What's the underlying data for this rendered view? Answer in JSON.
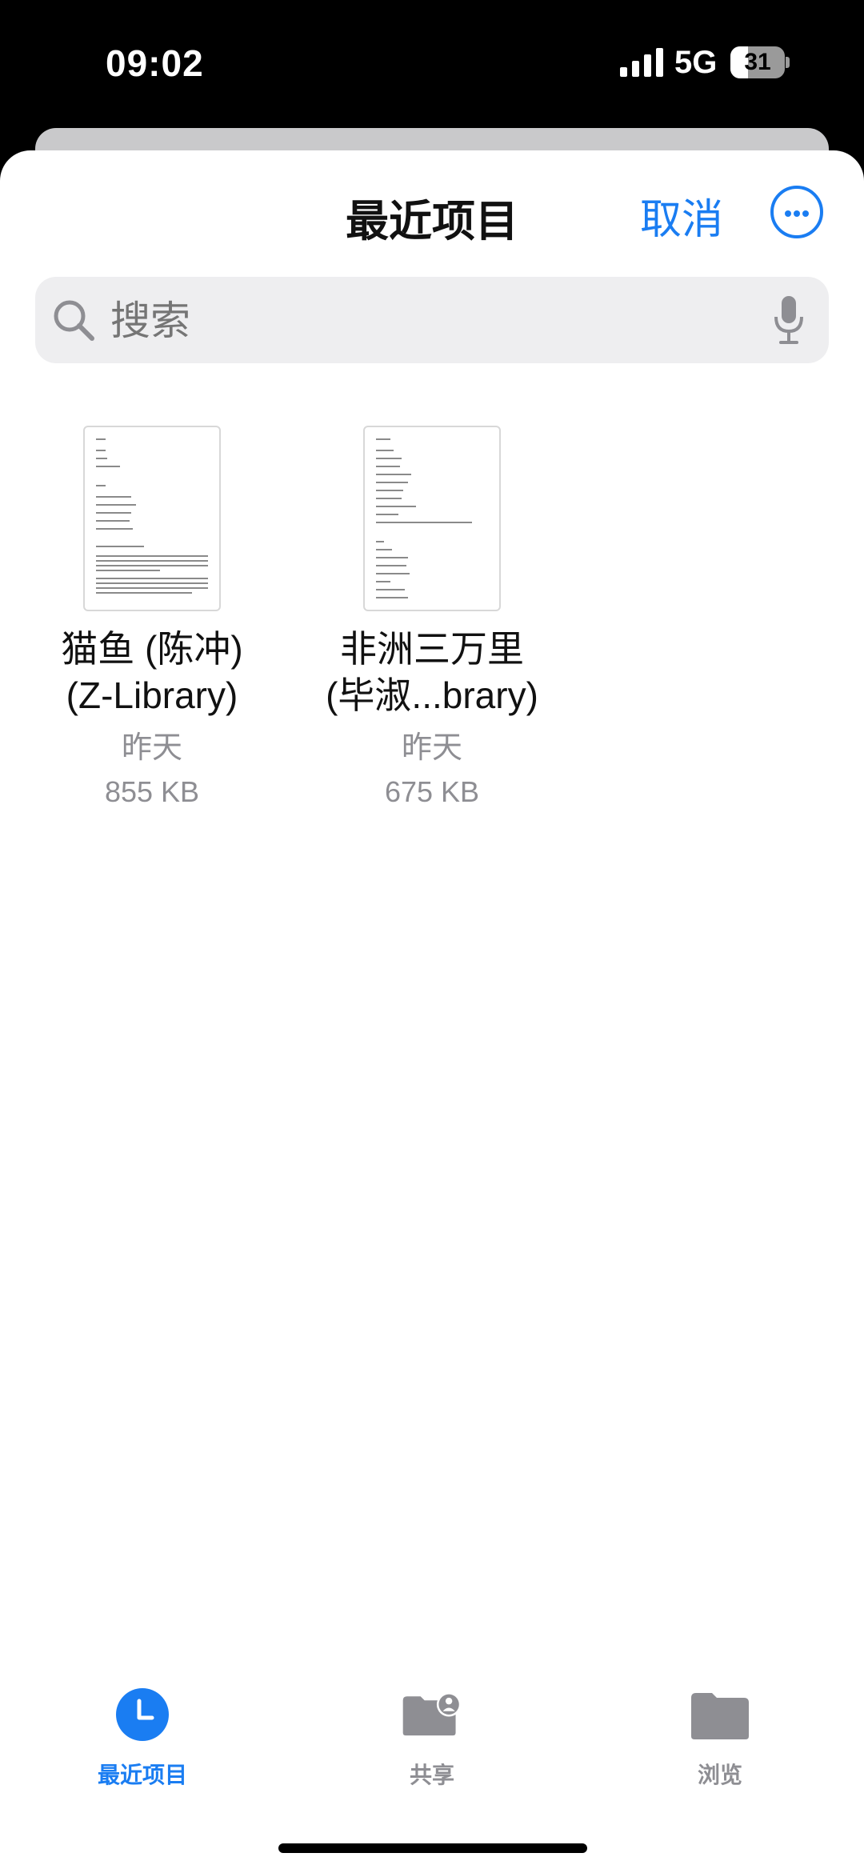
{
  "status_bar": {
    "time": "09:02",
    "network": "5G",
    "battery": "31"
  },
  "header": {
    "title": "最近项目",
    "cancel_label": "取消",
    "more_icon": "ellipsis-circle-icon"
  },
  "search": {
    "placeholder": "搜索",
    "search_icon": "magnifier-icon",
    "mic_icon": "microphone-icon"
  },
  "files": [
    {
      "name_line1": "猫鱼 (陈冲)",
      "name_line2": "(Z-Library)",
      "date": "昨天",
      "size": "855 KB"
    },
    {
      "name_line1": "非洲三万里",
      "name_line2": "(毕淑...brary)",
      "date": "昨天",
      "size": "675 KB"
    }
  ],
  "tabs": [
    {
      "label": "最近项目",
      "icon": "clock-icon",
      "active": true
    },
    {
      "label": "共享",
      "icon": "shared-folder-icon",
      "active": false
    },
    {
      "label": "浏览",
      "icon": "folder-icon",
      "active": false
    }
  ],
  "colors": {
    "accent": "#1a7df2",
    "inactive": "#8e8e93"
  }
}
